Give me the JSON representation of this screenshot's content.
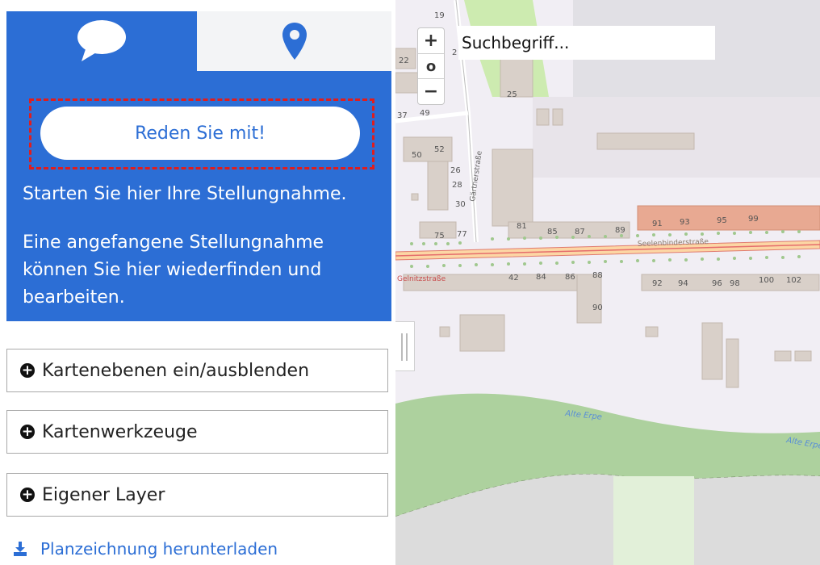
{
  "sidebar": {
    "tabs": [
      {
        "label": "",
        "icon": "speech-bubble-icon",
        "active": true
      },
      {
        "label": "",
        "icon": "map-pin-icon",
        "active": false
      }
    ],
    "cta_button_label": "Reden Sie mit!",
    "intro_text": "Starten Sie hier Ihre Stellungnahme.",
    "resume_text": "Eine angefangene Stellungnahme können Sie hier wiederfinden und bearbeiten.",
    "accordions": [
      {
        "label": "Kartenebenen ein/ausblenden",
        "icon": "plus-circle-icon"
      },
      {
        "label": "Kartenwerkzeuge",
        "icon": "plus-circle-icon"
      },
      {
        "label": "Eigener Layer",
        "icon": "plus-circle-icon"
      }
    ],
    "download_link": {
      "label": "Planzeichnung herunterladen",
      "icon": "download-icon"
    }
  },
  "map": {
    "search": {
      "placeholder": "Suchbegriff..."
    },
    "zoom": {
      "in": "+",
      "reset": "o",
      "out": "−"
    },
    "street_labels": [
      "Gelnitzstraße",
      "Seelenbinderstraße",
      "Gärtnerstraße"
    ],
    "waterway_labels": [
      "Alte Erpe",
      "Alte Erpe"
    ],
    "house_numbers": [
      "19",
      "22",
      "2",
      "25",
      "49",
      "50",
      "52",
      "26",
      "28",
      "30",
      "75",
      "77",
      "81",
      "85",
      "87",
      "89",
      "91",
      "93",
      "95",
      "99",
      "42",
      "84",
      "86",
      "88",
      "90",
      "92",
      "94",
      "96",
      "98",
      "100",
      "102",
      "37"
    ]
  },
  "colors": {
    "accent_blue": "#2c6ed5",
    "highlight_red": "#e01d1d",
    "map_background": "#f1eef4",
    "building": "#d9d0c9",
    "park_green": "#add19e",
    "water_green": "#add19e"
  }
}
